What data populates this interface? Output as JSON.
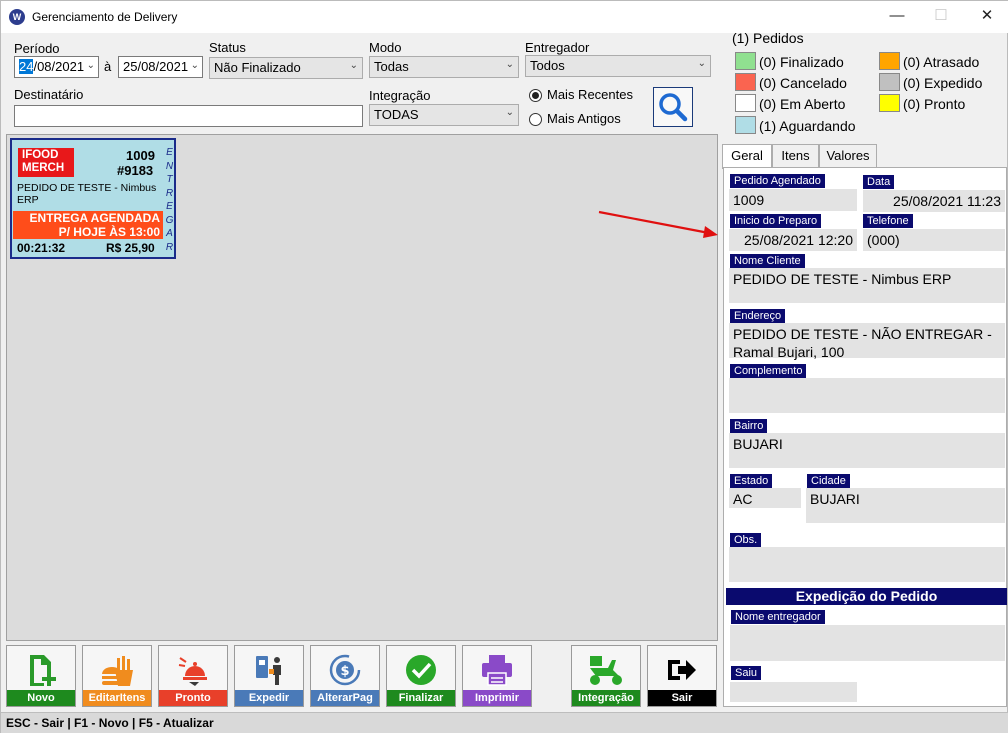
{
  "window": {
    "title": "Gerenciamento de Delivery",
    "icon_text": "W"
  },
  "filters": {
    "periodo_label": "Período",
    "date_from_day": "24",
    "date_from_rest": "/08/2021",
    "date_sep": "à",
    "date_to": "25/08/2021",
    "status_label": "Status",
    "status_value": "Não Finalizado",
    "modo_label": "Modo",
    "modo_value": "Todas",
    "entregador_label": "Entregador",
    "entregador_value": "Todos",
    "destinatario_label": "Destinatário",
    "destinatario_value": "",
    "integracao_label": "Integração",
    "integracao_value": "TODAS",
    "sort_recent": "Mais Recentes",
    "sort_old": "Mais Antigos"
  },
  "legend": {
    "title": "(1) Pedidos",
    "items": [
      {
        "label": "(0) Finalizado",
        "color": "#90e090"
      },
      {
        "label": "(0) Atrasado",
        "color": "#ffa500"
      },
      {
        "label": "(0) Cancelado",
        "color": "#fa6450"
      },
      {
        "label": "(0) Expedido",
        "color": "#c0c0c0"
      },
      {
        "label": "(0) Em Aberto",
        "color": "#ffffff"
      },
      {
        "label": "(0) Pronto",
        "color": "#ffff00"
      },
      {
        "label": "(1) Aguardando",
        "color": "#b0dde6"
      }
    ]
  },
  "order_card": {
    "source_line1": "IFOOD",
    "source_line2": "MERCH",
    "number": "1009",
    "code": "#9183",
    "customer_line1": "PEDIDO DE TESTE - Nimbus",
    "customer_line2": "ERP",
    "alert_line1": "ENTREGA AGENDADA",
    "alert_line2": "P/ HOJE ÀS 13:00",
    "elapsed": "00:21:32",
    "total": "R$ 25,90",
    "side_label": [
      "E",
      "N",
      "T",
      "R",
      "E",
      "G",
      "A",
      "R"
    ]
  },
  "tabs": [
    "Geral",
    "Itens",
    "Valores"
  ],
  "details": {
    "pedido_agendado_label": "Pedido Agendado",
    "pedido_agendado": "1009",
    "data_label": "Data",
    "data": "25/08/2021 11:23",
    "inicio_label": "Inicio do Preparo",
    "inicio": "25/08/2021 12:20",
    "telefone_label": "Telefone",
    "telefone": "(000)",
    "nome_label": "Nome Cliente",
    "nome": "PEDIDO DE TESTE - Nimbus ERP",
    "endereco_label": "Endereço",
    "endereco_line1": "PEDIDO DE TESTE - NÃO ENTREGAR -",
    "endereco_line2": "Ramal Bujari, 100",
    "complemento_label": "Complemento",
    "complemento": "",
    "bairro_label": "Bairro",
    "bairro": "BUJARI",
    "estado_label": "Estado",
    "estado": "AC",
    "cidade_label": "Cidade",
    "cidade": "BUJARI",
    "obs_label": "Obs.",
    "obs": ""
  },
  "expedicao": {
    "title": "Expedição do Pedido",
    "entregador_label": "Nome entregador",
    "entregador": "",
    "saiu_label": "Saiu",
    "saiu": ""
  },
  "toolbar": {
    "buttons": [
      {
        "label": "Novo",
        "color": "#1e8a1e"
      },
      {
        "label": "EditarItens",
        "color": "#f08c1e"
      },
      {
        "label": "Pronto",
        "color": "#e8402a"
      },
      {
        "label": "Expedir",
        "color": "#4a7ab8"
      },
      {
        "label": "AlterarPag",
        "color": "#4a7ab8"
      },
      {
        "label": "Finalizar",
        "color": "#1e8a1e"
      },
      {
        "label": "Imprimir",
        "color": "#8a4ac8"
      },
      {
        "label": "Integração",
        "color": "#1e8a1e"
      },
      {
        "label": "Sair",
        "color": "#000000"
      }
    ]
  },
  "statusbar": {
    "text": "ESC - Sair | F1 - Novo | F5 - Atualizar"
  }
}
